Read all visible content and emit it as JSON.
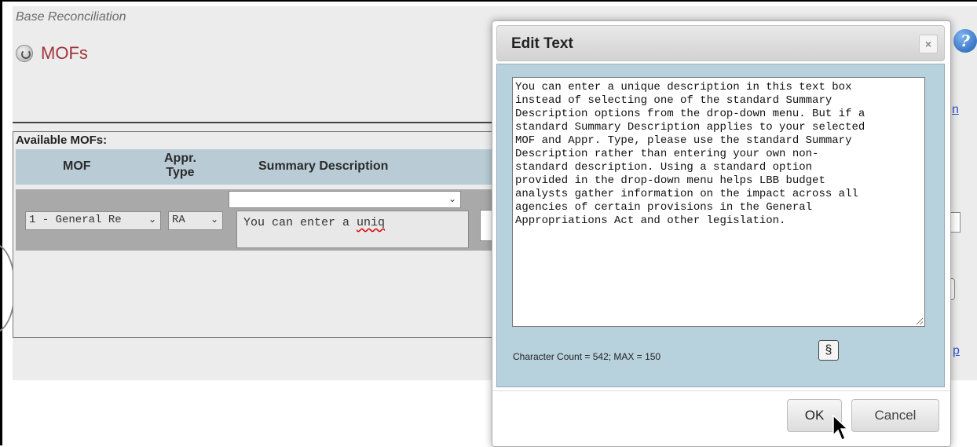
{
  "breadcrumb": "Base Reconciliation",
  "page_title": "MOFs",
  "right_link_top": "n",
  "right_link_bottom": "p",
  "table": {
    "section_label": "Available MOFs:",
    "headers": {
      "mof": "MOF",
      "appr_line1": "Appr.",
      "appr_line2": "Type",
      "summary": "Summary Description"
    },
    "row": {
      "mof_value": "1 - General Re",
      "appr_value": "RA",
      "summary_select": "",
      "summary_text_prefix": "You can enter a ",
      "summary_text_misspelled": "uniq"
    }
  },
  "dialog": {
    "title": "Edit Text",
    "close_glyph": "×",
    "text": "You can enter a unique description in this text box\ninstead of selecting one of the standard Summary\nDescription options from the drop-down menu. But if a\nstandard Summary Description applies to your selected\nMOF and Appr. Type, please use the standard Summary\nDescription rather than entering your own non-\nstandard description. Using a standard option\nprovided in the drop-down menu helps LBB budget\nanalysts gather information on the impact across all\nagencies of certain provisions in the General\nAppropriations Act and other legislation.",
    "char_count": "Character Count = 542; MAX = 150",
    "section_button": "§",
    "ok_label": "OK",
    "cancel_label": "Cancel"
  },
  "colors": {
    "title_red": "#a1343c",
    "table_header": "#b9ccd6",
    "dialog_body": "#b8d2dd"
  }
}
